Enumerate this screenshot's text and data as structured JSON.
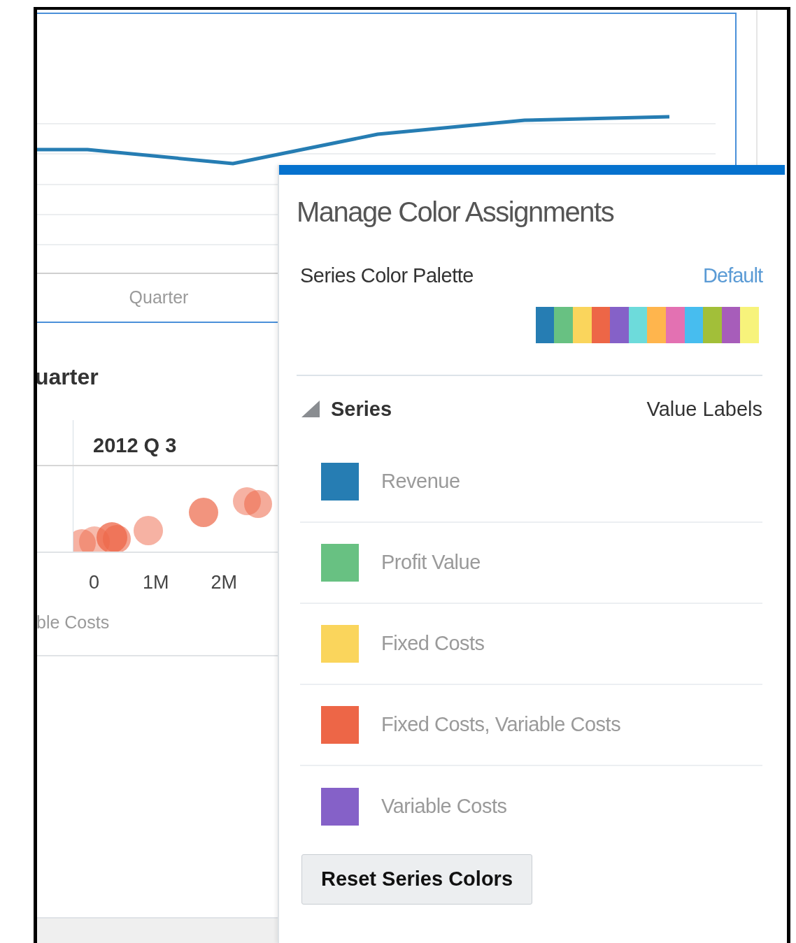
{
  "background": {
    "axis_label": "Quarter",
    "chart_title": "uarter",
    "column_header": "2012 Q 3",
    "x_ticks": [
      "0",
      "1M",
      "2M"
    ],
    "x_axis_label": "ble Costs"
  },
  "dialog": {
    "title": "Manage Color Assignments",
    "palette_label": "Series Color Palette",
    "palette_link": "Default",
    "palette": [
      {
        "color": "#267db3"
      },
      {
        "color": "#68c182"
      },
      {
        "color": "#fad55c"
      },
      {
        "color": "#ed6647"
      },
      {
        "color": "#8561c8"
      },
      {
        "color": "#6ddbdb"
      },
      {
        "color": "#ffb54d"
      },
      {
        "color": "#e371b2"
      },
      {
        "color": "#47bdef"
      },
      {
        "color": "#a2bf39"
      },
      {
        "color": "#a75dba"
      },
      {
        "color": "#f7f37b"
      }
    ],
    "series_header": "Series",
    "series_expanded": true,
    "value_labels_header": "Value Labels",
    "series": [
      {
        "name": "Revenue",
        "color": "#267db3"
      },
      {
        "name": "Profit Value",
        "color": "#68c182"
      },
      {
        "name": "Fixed Costs",
        "color": "#fad55c"
      },
      {
        "name": "Fixed Costs, Variable Costs",
        "color": "#ed6647"
      },
      {
        "name": "Variable Costs",
        "color": "#8561c8"
      }
    ],
    "reset_button": "Reset Series Colors"
  }
}
